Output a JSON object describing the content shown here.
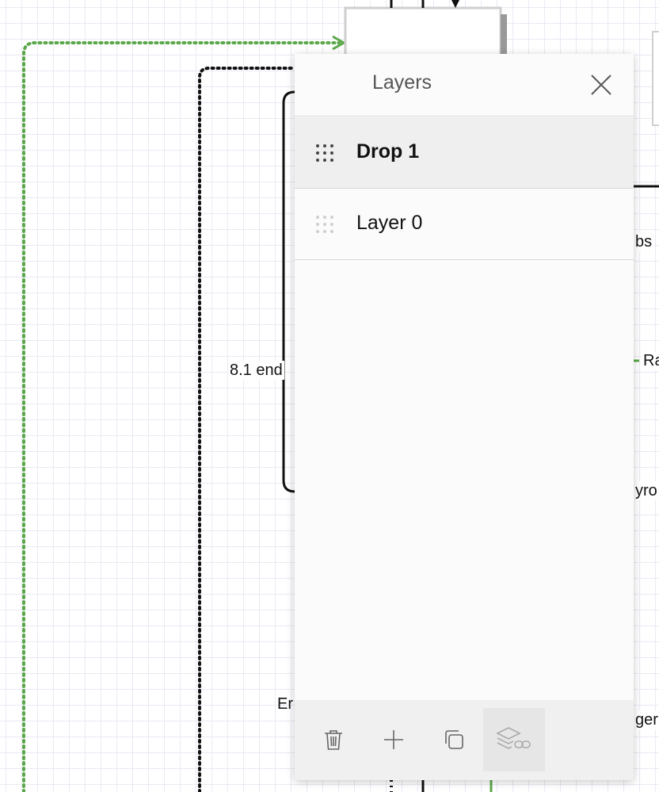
{
  "canvas": {
    "labels": {
      "end": "8.1 end",
      "en": "Er",
      "obs": "bs",
      "ra": "Ra",
      "yro": "yro",
      "ger": "ger"
    }
  },
  "layers_panel": {
    "title": "Layers",
    "close_icon": "close-icon",
    "layers": [
      {
        "name": "Drop 1",
        "selected": true,
        "bold": true
      },
      {
        "name": "Layer 0",
        "selected": false,
        "bold": false
      }
    ],
    "toolbar": [
      {
        "icon": "trash-icon",
        "enabled": true
      },
      {
        "icon": "plus-icon",
        "enabled": true
      },
      {
        "icon": "duplicate-icon",
        "enabled": true
      },
      {
        "icon": "layers-link-icon",
        "enabled": false
      }
    ]
  }
}
